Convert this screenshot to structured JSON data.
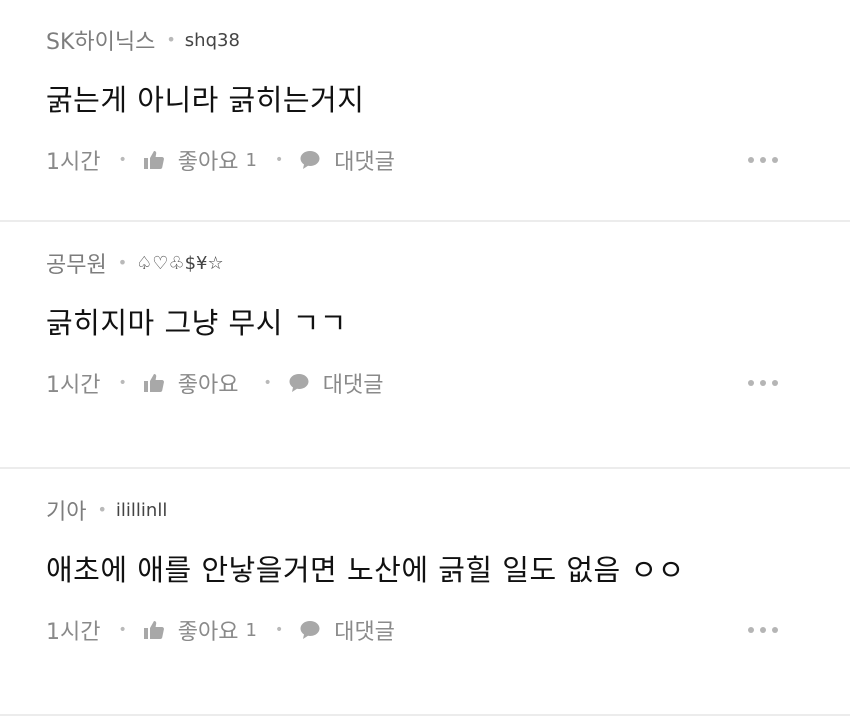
{
  "comments": [
    {
      "company": "SK하이닉스",
      "nickname": "shq38",
      "text": "굵는게 아니라 긁히는거지",
      "time": "1시간",
      "like_label": "좋아요",
      "like_count": "1",
      "reply_label": "대댓글"
    },
    {
      "company": "공무원",
      "nickname": "♤♡♧$¥☆",
      "text": "긁히지마 그냥 무시 ㄱㄱ",
      "time": "1시간",
      "like_label": "좋아요",
      "like_count": "",
      "reply_label": "대댓글"
    },
    {
      "company": "기아",
      "nickname": "ilillinll",
      "text": "애초에 애를 안낳을거면 노산에 긁힐 일도 없음 ㅇㅇ",
      "time": "1시간",
      "like_label": "좋아요",
      "like_count": "1",
      "reply_label": "대댓글"
    }
  ],
  "icons": {
    "like": "thumbs-up-icon",
    "reply": "speech-bubble-icon",
    "more": "more-dots-icon"
  },
  "colors": {
    "meta_text": "#7d7d7d",
    "action_text": "#8a8a8a",
    "divider": "#ececec"
  }
}
